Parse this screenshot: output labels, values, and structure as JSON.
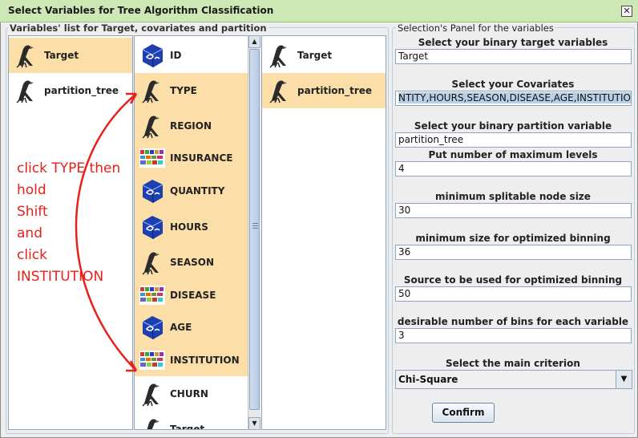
{
  "window": {
    "title": "Select Variables for Tree Algorithm Classification",
    "close_glyph": "✕"
  },
  "left_panel": {
    "legend": "Variables' list for Target, covariates and partition",
    "roles": [
      {
        "label": "Target",
        "icon": "bird-icon",
        "selected": true
      },
      {
        "label": "partition_tree",
        "icon": "bird-icon",
        "selected": false
      }
    ]
  },
  "variables": [
    {
      "label": "ID",
      "icon": "cube-icon",
      "selected": false
    },
    {
      "label": "TYPE",
      "icon": "bird-icon",
      "selected": true
    },
    {
      "label": "REGION",
      "icon": "bird-icon",
      "selected": true
    },
    {
      "label": "INSURANCE",
      "icon": "text-data-icon",
      "selected": true
    },
    {
      "label": "QUANTITY",
      "icon": "cube-icon",
      "selected": true
    },
    {
      "label": "HOURS",
      "icon": "cube-icon",
      "selected": true
    },
    {
      "label": "SEASON",
      "icon": "bird-icon",
      "selected": true
    },
    {
      "label": "DISEASE",
      "icon": "text-data-icon",
      "selected": true
    },
    {
      "label": "AGE",
      "icon": "cube-icon",
      "selected": true
    },
    {
      "label": "INSTITUTION",
      "icon": "text-data-icon",
      "selected": true
    },
    {
      "label": "CHURN",
      "icon": "bird-icon",
      "selected": false
    },
    {
      "label": "Target",
      "icon": "bird-icon",
      "selected": false
    }
  ],
  "assigned": [
    {
      "label": "Target",
      "icon": "bird-icon",
      "selected": false
    },
    {
      "label": "partition_tree",
      "icon": "bird-icon",
      "selected": true
    }
  ],
  "annotation": {
    "text": "click TYPE then\nhold\nShift\nand\nclick\nINSTITUTION",
    "color": "#e8201a"
  },
  "selection_panel": {
    "legend": "Selection's Panel for the variables",
    "target_label": "Select your binary target variables",
    "target_value": "Target",
    "covariates_label": "Select your Covariates",
    "covariates_value": "NTITY,HOURS,SEASON,DISEASE,AGE,INSTITUTION",
    "partition_label": "Select your binary partition variable",
    "partition_value": "partition_tree",
    "max_levels_label": "Put number of maximum levels",
    "max_levels_value": "4",
    "min_split_label": "minimum splitable node size",
    "min_split_value": "30",
    "min_bin_label": "minimum size for optimized binning",
    "min_bin_value": "36",
    "source_label": "Source to be used for optimized binning",
    "source_value": "50",
    "bins_label": "desirable number of bins for each variable",
    "bins_value": "3",
    "criterion_label": "Select the main criterion",
    "criterion_value": "Chi-Square",
    "confirm_label": "Confirm"
  },
  "colors": {
    "selection": "#fcdfa8",
    "titlebar": "#cde7b5",
    "accent_border": "#8ea4bf"
  }
}
